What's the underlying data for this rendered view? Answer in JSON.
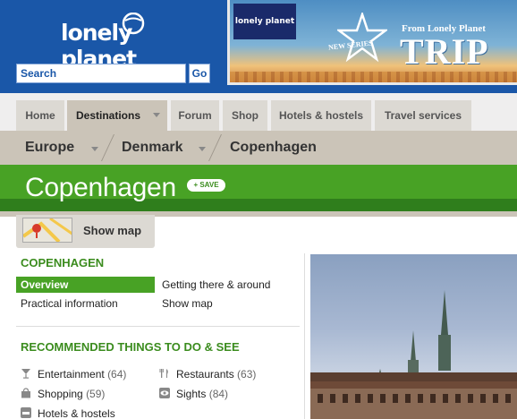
{
  "header": {
    "logo_text": "lonely planet",
    "search_placeholder": "Search",
    "go_label": "Go"
  },
  "banner": {
    "logo_text": "lonely planet",
    "badge_text": "NEW SERIES",
    "from_text": "From Lonely Planet",
    "headline": "TRIP"
  },
  "nav": {
    "tabs": [
      {
        "label": "Home"
      },
      {
        "label": "Destinations"
      },
      {
        "label": "Forum"
      },
      {
        "label": "Shop"
      },
      {
        "label": "Hotels & hostels"
      },
      {
        "label": "Travel services"
      }
    ]
  },
  "breadcrumb": [
    "Europe",
    "Denmark",
    "Copenhagen"
  ],
  "page": {
    "title": "Copenhagen",
    "save_label": "+ SAVE"
  },
  "map": {
    "label": "Show map"
  },
  "section": {
    "heading": "COPENHAGEN",
    "links": {
      "overview": "Overview",
      "getting_there": "Getting there & around",
      "practical": "Practical information",
      "show_map": "Show map"
    }
  },
  "recommended": {
    "heading": "RECOMMENDED THINGS TO DO & SEE",
    "items": [
      {
        "label": "Entertainment",
        "count": "(64)",
        "icon": "cocktail-icon"
      },
      {
        "label": "Restaurants",
        "count": "(63)",
        "icon": "cutlery-icon"
      },
      {
        "label": "Shopping",
        "count": "(59)",
        "icon": "shopping-bag-icon"
      },
      {
        "label": "Sights",
        "count": "(84)",
        "icon": "eye-icon"
      },
      {
        "label": "Hotels & hostels",
        "count": "",
        "icon": "bed-icon"
      }
    ]
  },
  "colors": {
    "header_blue": "#1a57a8",
    "brand_green": "#48a225",
    "tab_gray": "#dcd9d3"
  }
}
